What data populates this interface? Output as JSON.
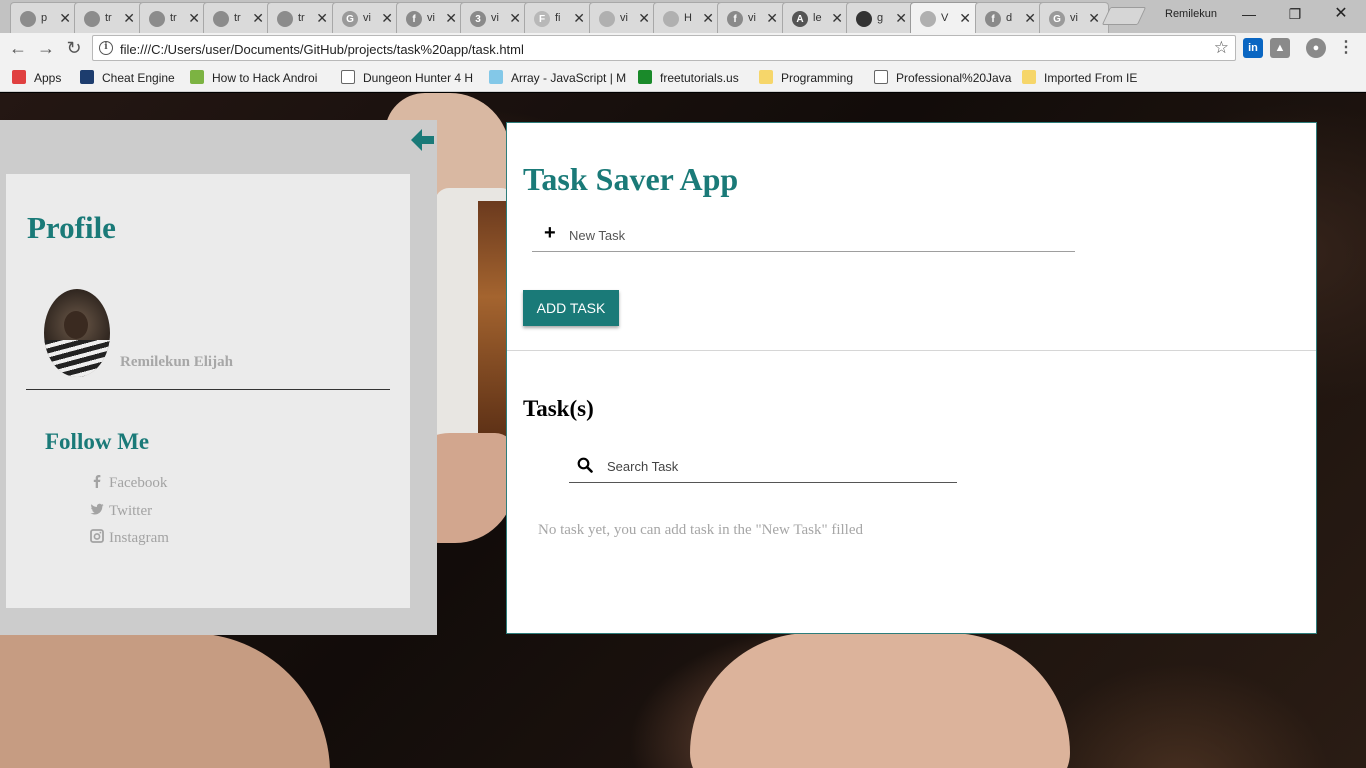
{
  "browser": {
    "tabs": [
      {
        "label": "p",
        "favicon": "chrome",
        "color": "#8c8c8c"
      },
      {
        "label": "tr",
        "favicon": "chrome",
        "color": "#8c8c8c"
      },
      {
        "label": "tr",
        "favicon": "chrome",
        "color": "#8c8c8c"
      },
      {
        "label": "tr",
        "favicon": "chrome",
        "color": "#8c8c8c"
      },
      {
        "label": "tr",
        "favicon": "chrome",
        "color": "#8c8c8c"
      },
      {
        "label": "vi",
        "favicon": "G",
        "color": "#9a9a9a"
      },
      {
        "label": "vi",
        "favicon": "f",
        "color": "#8a8a8a"
      },
      {
        "label": "vi",
        "favicon": "3",
        "color": "#8a8a8a"
      },
      {
        "label": "fi",
        "favicon": "F",
        "color": "#b8b8b8"
      },
      {
        "label": "vi",
        "favicon": "pocket",
        "color": "#b0b0b0"
      },
      {
        "label": "H",
        "favicon": "doc",
        "color": "#b0b0b0"
      },
      {
        "label": "vi",
        "favicon": "f",
        "color": "#8a8a8a"
      },
      {
        "label": "le",
        "favicon": "A",
        "color": "#555555"
      },
      {
        "label": "g",
        "favicon": "github",
        "color": "#333333"
      },
      {
        "label": "V",
        "favicon": "doc",
        "color": "#b0b0b0",
        "active": true
      },
      {
        "label": "d",
        "favicon": "f",
        "color": "#8a8a8a"
      },
      {
        "label": "vi",
        "favicon": "G",
        "color": "#9a9a9a"
      }
    ],
    "profile_name": "Remilekun",
    "url": "file:///C:/Users/user/Documents/GitHub/projects/task%20app/task.html",
    "bookmarks": [
      {
        "label": "Apps",
        "icon": "apps-icon",
        "color": "#e04040"
      },
      {
        "label": "Cheat Engine",
        "icon": "gear-icon",
        "color": "#1d3d6e"
      },
      {
        "label": "How to Hack Androi",
        "icon": "android-icon",
        "color": "#7cb342"
      },
      {
        "label": "Dungeon Hunter 4 H",
        "icon": "page-icon",
        "color": "#ffffff"
      },
      {
        "label": "Array - JavaScript | M",
        "icon": "mdn-icon",
        "color": "#83c8e8"
      },
      {
        "label": "freetutorials.us",
        "icon": "ftu-icon",
        "color": "#1a8a2a"
      },
      {
        "label": "Programming",
        "icon": "folder-icon",
        "color": "#f6d66a"
      },
      {
        "label": "Professional%20Java",
        "icon": "page-icon",
        "color": "#ffffff"
      },
      {
        "label": "Imported From IE",
        "icon": "folder-icon",
        "color": "#f6d66a"
      }
    ]
  },
  "sidebar": {
    "title": "Profile",
    "user_name": "Remilekun Elijah",
    "follow_title": "Follow Me",
    "links": [
      {
        "label": "Facebook",
        "icon": "facebook-icon"
      },
      {
        "label": "Twitter",
        "icon": "twitter-icon"
      },
      {
        "label": "Instagram",
        "icon": "instagram-icon"
      }
    ],
    "accent": "#1a7a78"
  },
  "main": {
    "title": "Task Saver App",
    "new_task_placeholder": "New Task",
    "add_button": "ADD TASK",
    "tasks_heading": "Task(s)",
    "search_placeholder": "Search Task",
    "empty_message": "No task yet, you can add task in the \"New Task\" filled"
  }
}
